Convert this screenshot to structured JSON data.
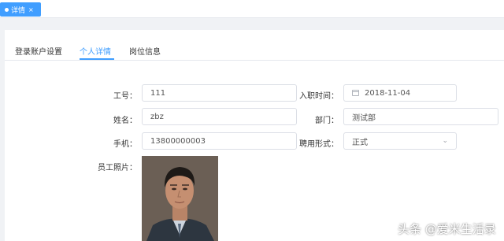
{
  "top_tab": {
    "label": "详情",
    "close": "×"
  },
  "subtabs": [
    {
      "label": "登录账户设置"
    },
    {
      "label": "个人详情"
    },
    {
      "label": "岗位信息"
    }
  ],
  "form": {
    "employee_no": {
      "label": "工号：",
      "value": "111"
    },
    "hire_date": {
      "label": "入职时间：",
      "value": "2018-11-04"
    },
    "name": {
      "label": "姓名：",
      "value": "zbz"
    },
    "department": {
      "label": "部门：",
      "value": "测试部"
    },
    "phone": {
      "label": "手机：",
      "value": "13800000003"
    },
    "employment_type": {
      "label": "聘用形式：",
      "value": "正式"
    },
    "photo": {
      "label": "员工照片："
    }
  },
  "watermark": "头条 @爱米生活录",
  "colors": {
    "accent": "#409eff"
  }
}
